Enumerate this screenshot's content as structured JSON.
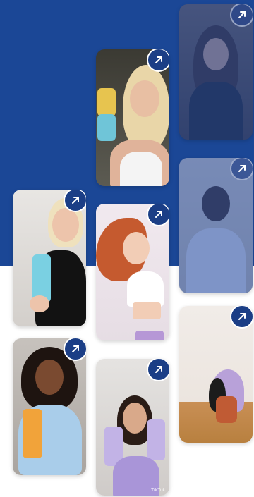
{
  "gallery": {
    "title": "",
    "items": [
      {
        "id": "video-1",
        "watermark": ""
      },
      {
        "id": "video-2",
        "watermark": ""
      },
      {
        "id": "video-3",
        "watermark": ""
      },
      {
        "id": "video-4",
        "watermark": ""
      },
      {
        "id": "video-5",
        "watermark": ""
      },
      {
        "id": "video-6",
        "watermark": ""
      },
      {
        "id": "video-7",
        "watermark": "TikTok"
      },
      {
        "id": "video-8",
        "watermark": ""
      }
    ]
  },
  "colors": {
    "band": "#1b4796",
    "link_button": "#1b3e86",
    "page_background": "#ffffff"
  },
  "icons": {
    "open_link": "arrow-up-right-icon"
  }
}
